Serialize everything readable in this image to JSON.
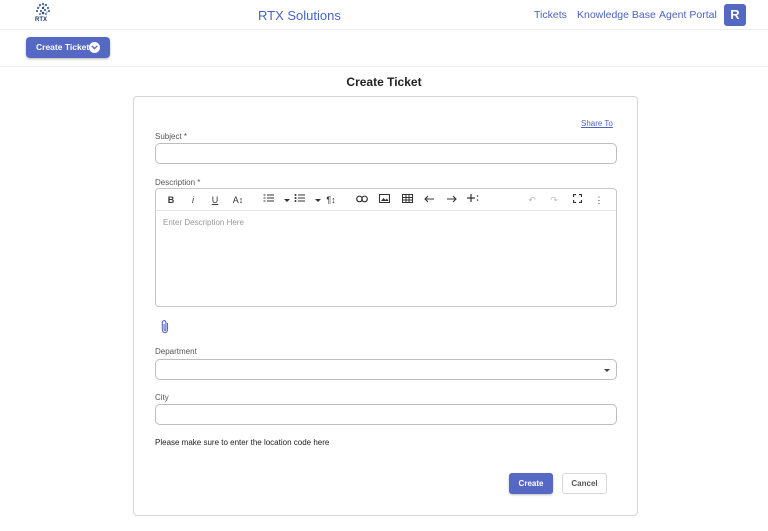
{
  "header": {
    "logo_text": "RTX",
    "brand": "RTX Solutions",
    "nav": [
      "Tickets",
      "Knowledge Base",
      "Agent Portal"
    ],
    "avatar_letter": "R"
  },
  "actions": {
    "create_ticket_label": "Create Ticket"
  },
  "page": {
    "title": "Create Ticket"
  },
  "form": {
    "share_label": "Share To",
    "subject_label": "Subject *",
    "subject_value": "",
    "description_label": "Description *",
    "description_placeholder": "Enter Description Here",
    "department_label": "Department",
    "department_value": "",
    "city_label": "City",
    "city_value": "",
    "hint": "Please make sure to enter the location code here",
    "create_label": "Create",
    "cancel_label": "Cancel"
  },
  "toolbar": {
    "bold": "B",
    "italic": "i",
    "underline": "U",
    "font_size": "A↕",
    "paragraph": "¶↕",
    "undo": "↶",
    "redo": "↷",
    "more": "⋮"
  },
  "colors": {
    "accent": "#5468c4",
    "link": "#4a63c4"
  }
}
